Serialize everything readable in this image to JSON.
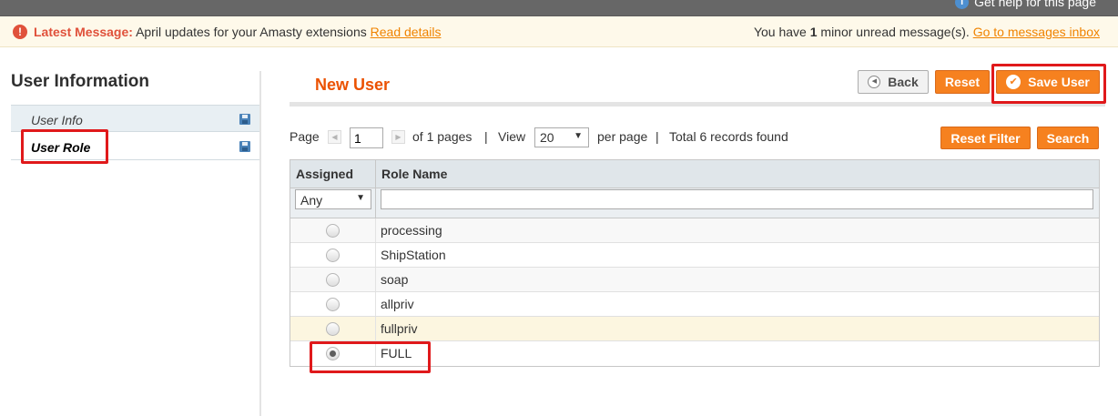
{
  "header": {
    "help_text": "Get help for this page"
  },
  "message_bar": {
    "label": "Latest Message:",
    "text": "April updates for your Amasty extensions",
    "link": "Read details",
    "right_prefix": "You have",
    "right_count": "1",
    "right_suffix": "minor unread message(s).",
    "right_link": "Go to messages inbox"
  },
  "sidebar": {
    "title": "User Information",
    "items": [
      {
        "label": "User Info"
      },
      {
        "label": "User Role"
      }
    ]
  },
  "main": {
    "title": "New User",
    "buttons": {
      "back": "Back",
      "reset": "Reset",
      "save": "Save User"
    }
  },
  "pager": {
    "page_label": "Page",
    "page_value": "1",
    "of_pages": "of 1 pages",
    "sep1": "|",
    "view_label": "View",
    "view_value": "20",
    "per_page": "per page",
    "sep2": "|",
    "total": "Total 6 records found",
    "reset_filter": "Reset Filter",
    "search": "Search"
  },
  "grid": {
    "columns": [
      "Assigned",
      "Role Name"
    ],
    "filter": {
      "assigned_value": "Any",
      "role_value": ""
    },
    "rows": [
      {
        "role": "processing",
        "checked": false
      },
      {
        "role": "ShipStation",
        "checked": false
      },
      {
        "role": "soap",
        "checked": false
      },
      {
        "role": "allpriv",
        "checked": false
      },
      {
        "role": "fullpriv",
        "checked": false
      },
      {
        "role": "FULL",
        "checked": true
      }
    ]
  },
  "colors": {
    "accent": "#eb5202",
    "button_orange": "#f6811f",
    "highlight_box": "#e0191b"
  }
}
